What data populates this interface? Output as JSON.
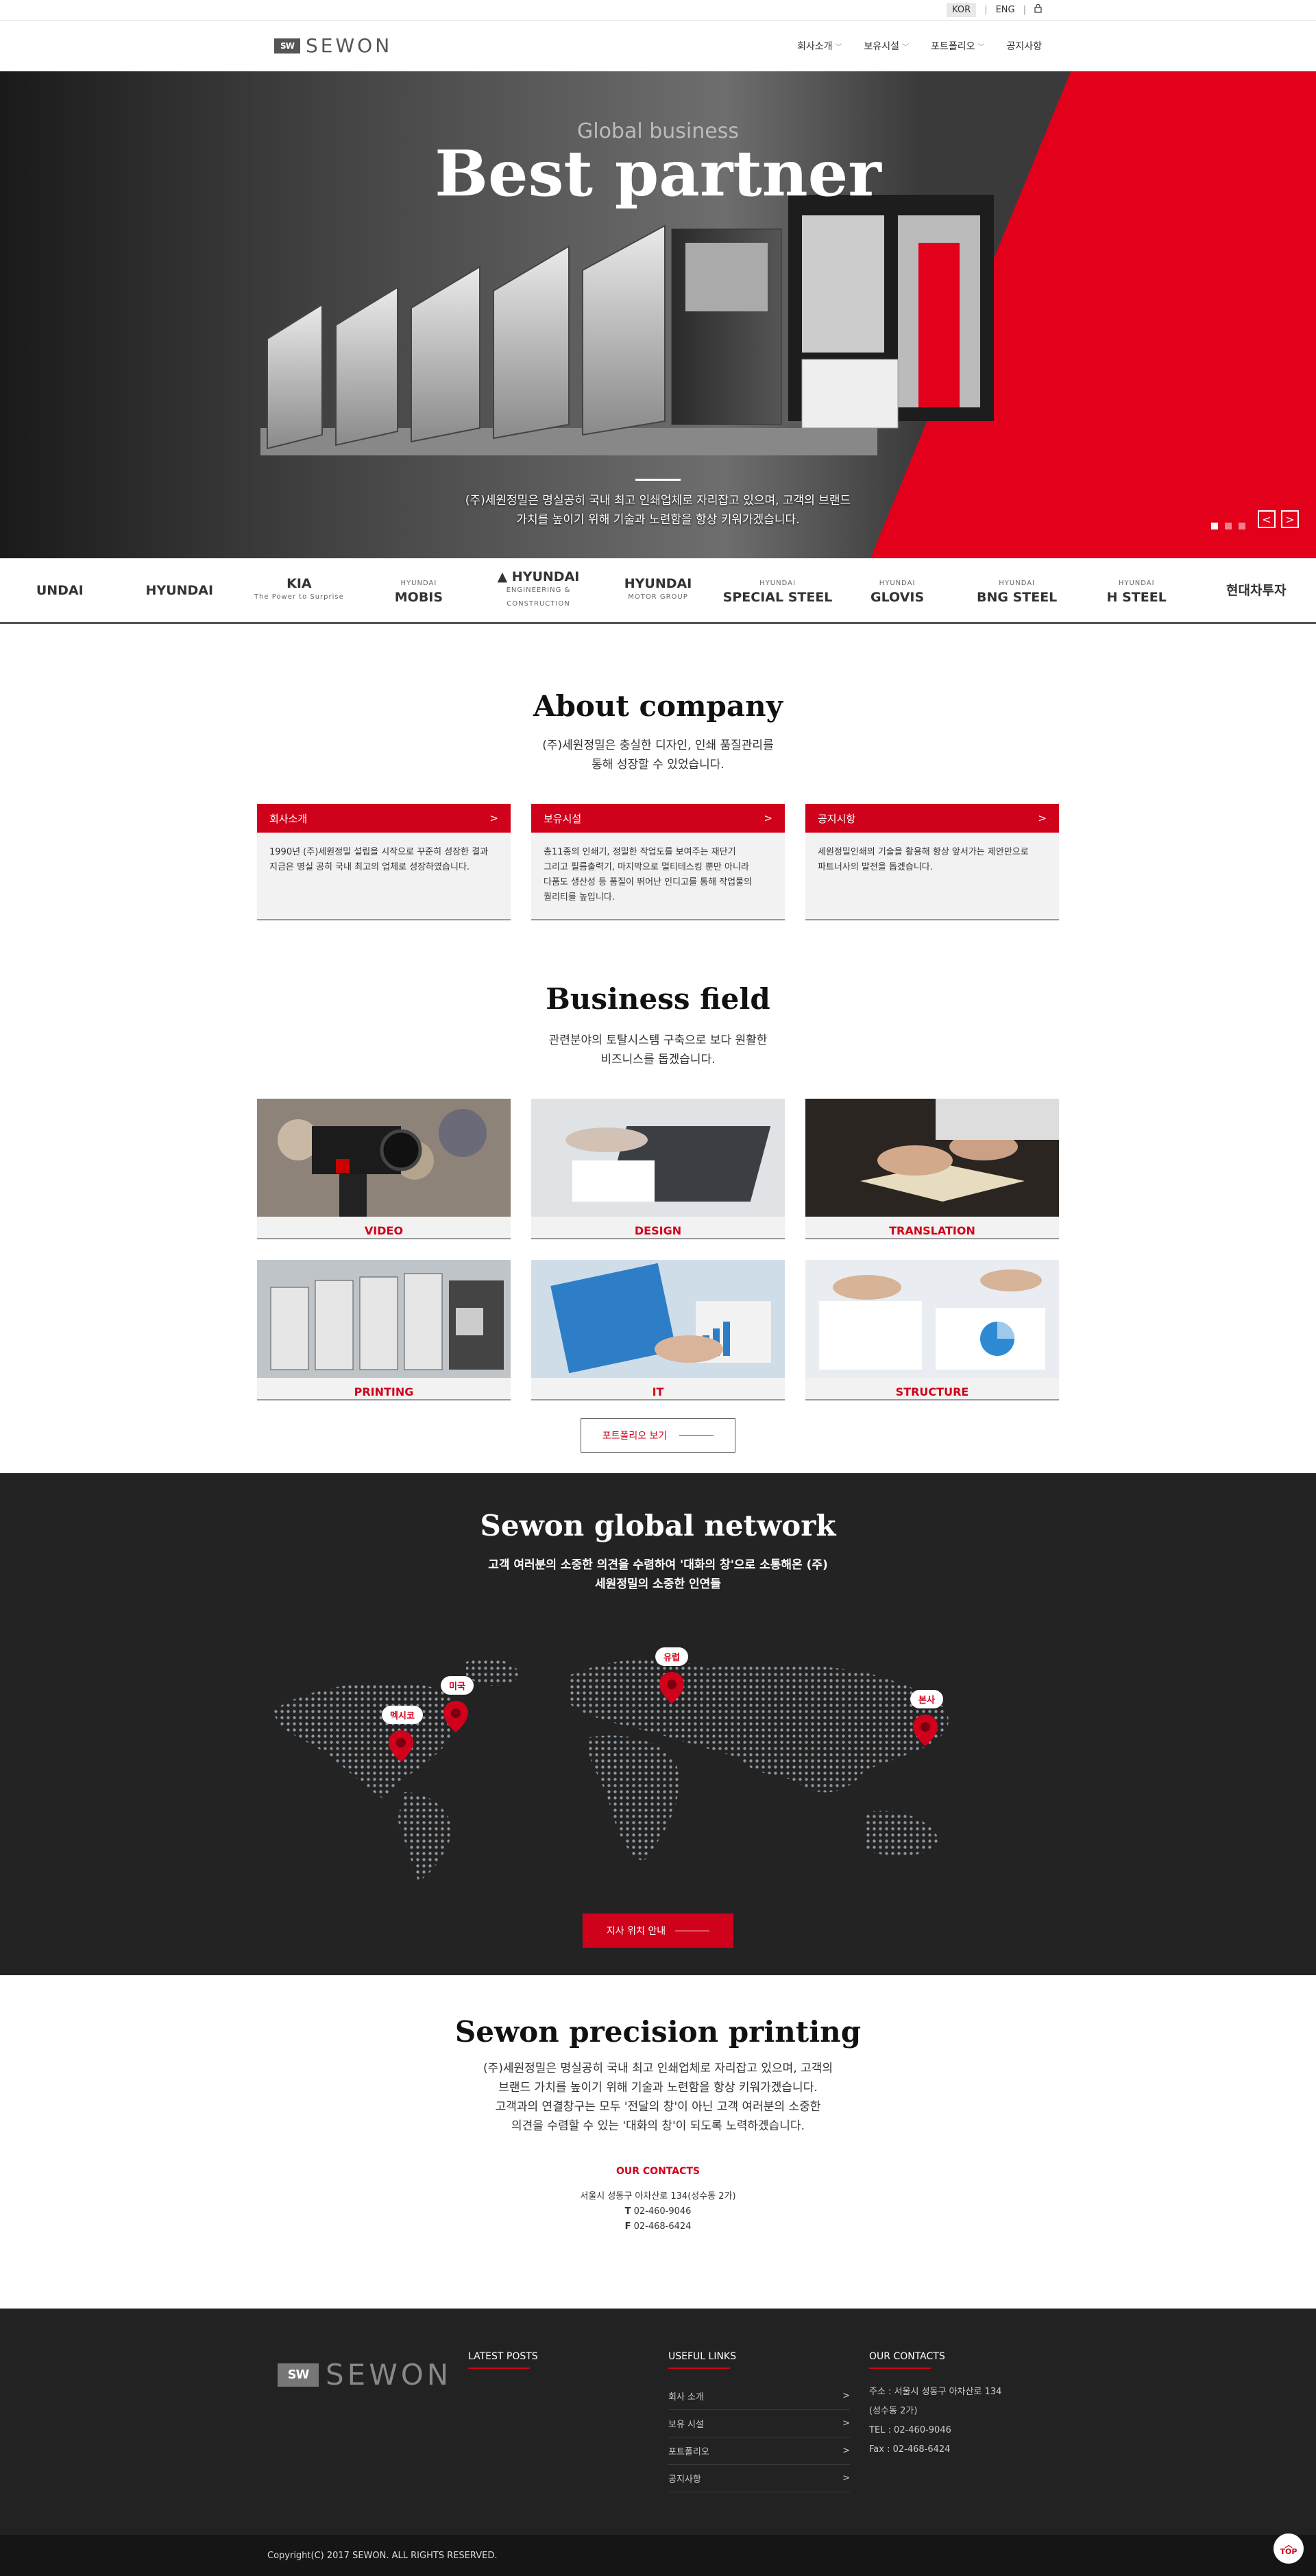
{
  "utility": {
    "lang_kor": "KOR",
    "lang_eng": "ENG",
    "separator": "|"
  },
  "header": {
    "logo_mark": "SW",
    "logo_text": "SEWON",
    "nav": [
      {
        "label": "회사소개",
        "has_dropdown": true
      },
      {
        "label": "보유시설",
        "has_dropdown": true
      },
      {
        "label": "포트폴리오",
        "has_dropdown": true
      },
      {
        "label": "공지사항",
        "has_dropdown": false
      }
    ]
  },
  "hero": {
    "subtitle": "Global business",
    "title": "Best partner",
    "desc_line1": "(주)세원정밀은 명실공히 국내 최고 인쇄업체로 자리잡고 있으며, 고객의 브랜드",
    "desc_line2": "가치를 높이기 위해 기술과 노련함을 항상 키워가겠습니다.",
    "prev": "<",
    "next": ">",
    "slides_count": 3,
    "active_slide": 1
  },
  "partners": [
    {
      "name": "UNDAI",
      "sub": ""
    },
    {
      "name": "HYUNDAI",
      "sub": ""
    },
    {
      "name": "KIA",
      "sub": "The Power to Surprise"
    },
    {
      "name": "MOBIS",
      "sub": "HYUNDAI"
    },
    {
      "name": "▲ HYUNDAI",
      "sub": "ENGINEERING & CONSTRUCTION"
    },
    {
      "name": "HYUNDAI",
      "sub": "MOTOR GROUP"
    },
    {
      "name": "SPECIAL STEEL",
      "sub": "HYUNDAI"
    },
    {
      "name": "GLOVIS",
      "sub": "HYUNDAI"
    },
    {
      "name": "BNG STEEL",
      "sub": "HYUNDAI"
    },
    {
      "name": "H STEEL",
      "sub": "HYUNDAI"
    },
    {
      "name": "현대차투자",
      "sub": ""
    }
  ],
  "about": {
    "title": "About company",
    "desc_line1": "(주)세원정밀은 충실한 디자인, 인쇄 품질관리를",
    "desc_line2": "통해 성장할 수 있었습니다.",
    "cards": [
      {
        "title": "회사소개",
        "arrow": ">",
        "lines": [
          "1990년 (주)세원정밀 설립을 시작으로 꾸준히 성장한 결과",
          "지금은 명실 공히 국내 최고의 업체로 성장하였습니다."
        ]
      },
      {
        "title": "보유시설",
        "arrow": ">",
        "lines": [
          "총11종의 인쇄기, 정밀한 작업도를 보여주는 재단기",
          "그리고 필름출력기, 마지막으로 멀티테스킹 뿐만 아니라",
          "다품도 생산성 등 품질이 뛰어난 인디고를 통해 작업물의",
          "퀄리티를 높입니다."
        ]
      },
      {
        "title": "공지시항",
        "arrow": ">",
        "lines": [
          "세원정밀인쇄의 기술을 활용해 항상 앞서가는 제안만으로",
          "파트너사의 발전을 돕겠습니다."
        ]
      }
    ]
  },
  "business": {
    "title": "Business field",
    "desc_line1": "관련분야의 토탈시스템 구축으로 보다 원활한",
    "desc_line2": "비즈니스를 돕겠습니다.",
    "items": [
      {
        "label": "VIDEO"
      },
      {
        "label": "DESIGN"
      },
      {
        "label": "TRANSLATION"
      },
      {
        "label": "PRINTING"
      },
      {
        "label": "IT"
      },
      {
        "label": "STRUCTURE"
      }
    ],
    "button_label": "포트폴리오 보기"
  },
  "network": {
    "title": "Sewon global network",
    "desc_line1": "고객 여러분의 소중한 의견을 수렴하여 '대화의 창'으로 소통해온 (주)",
    "desc_line2": "세원정밀의 소중한 인연들",
    "pins": [
      {
        "label": "멕시코"
      },
      {
        "label": "미국"
      },
      {
        "label": "유럽"
      },
      {
        "label": "본사"
      }
    ],
    "button_label": "지사 위치 안내"
  },
  "printing": {
    "title": "Sewon precision printing",
    "desc_line1": "(주)세원정밀은 명실공히 국내 최고 인쇄업체로 자리잡고 있으며, 고객의",
    "desc_line2": "브랜드 가치를 높이기 위해 기술과 노련함을 항상 키워가겠습니다.",
    "desc_line3": "고객과의 연결창구는 모두 '전달의 창'이 아닌 고객 여러분의 소중한",
    "desc_line4": "의견을 수렴할 수 있는 '대화의 창'이 되도록 노력하겠습니다.",
    "contacts_title": "OUR CONTACTS",
    "address": "서울시 성동구 아차산로 134(성수동 2가)",
    "tel_label": "T",
    "tel": "02-460-9046",
    "fax_label": "F",
    "fax": "02-468-6424"
  },
  "footer": {
    "logo_mark": "SW",
    "logo_text": "SEWON",
    "latest_posts_title": "LATEST POSTS",
    "useful_links_title": "USEFUL LINKS",
    "links": [
      {
        "label": "회사 소개",
        "arrow": ">"
      },
      {
        "label": "보유 시설",
        "arrow": ">"
      },
      {
        "label": "포트폴리오",
        "arrow": ">"
      },
      {
        "label": "공지사항",
        "arrow": ">"
      }
    ],
    "contacts_title": "OUR CONTACTS",
    "address_line1": "주소 : 서울시 성동구 아차산로 134",
    "address_line2": "(성수동 2가)",
    "tel": "TEL : 02-460-9046",
    "fax": "Fax : 02-468-6424"
  },
  "copyright": "Copyright(C) 2017 SEWON. ALL RIGHTS RESERVED.",
  "top_button": "TOP",
  "colors": {
    "accent": "#d0021b",
    "dark": "#232323",
    "footer": "#222222"
  }
}
